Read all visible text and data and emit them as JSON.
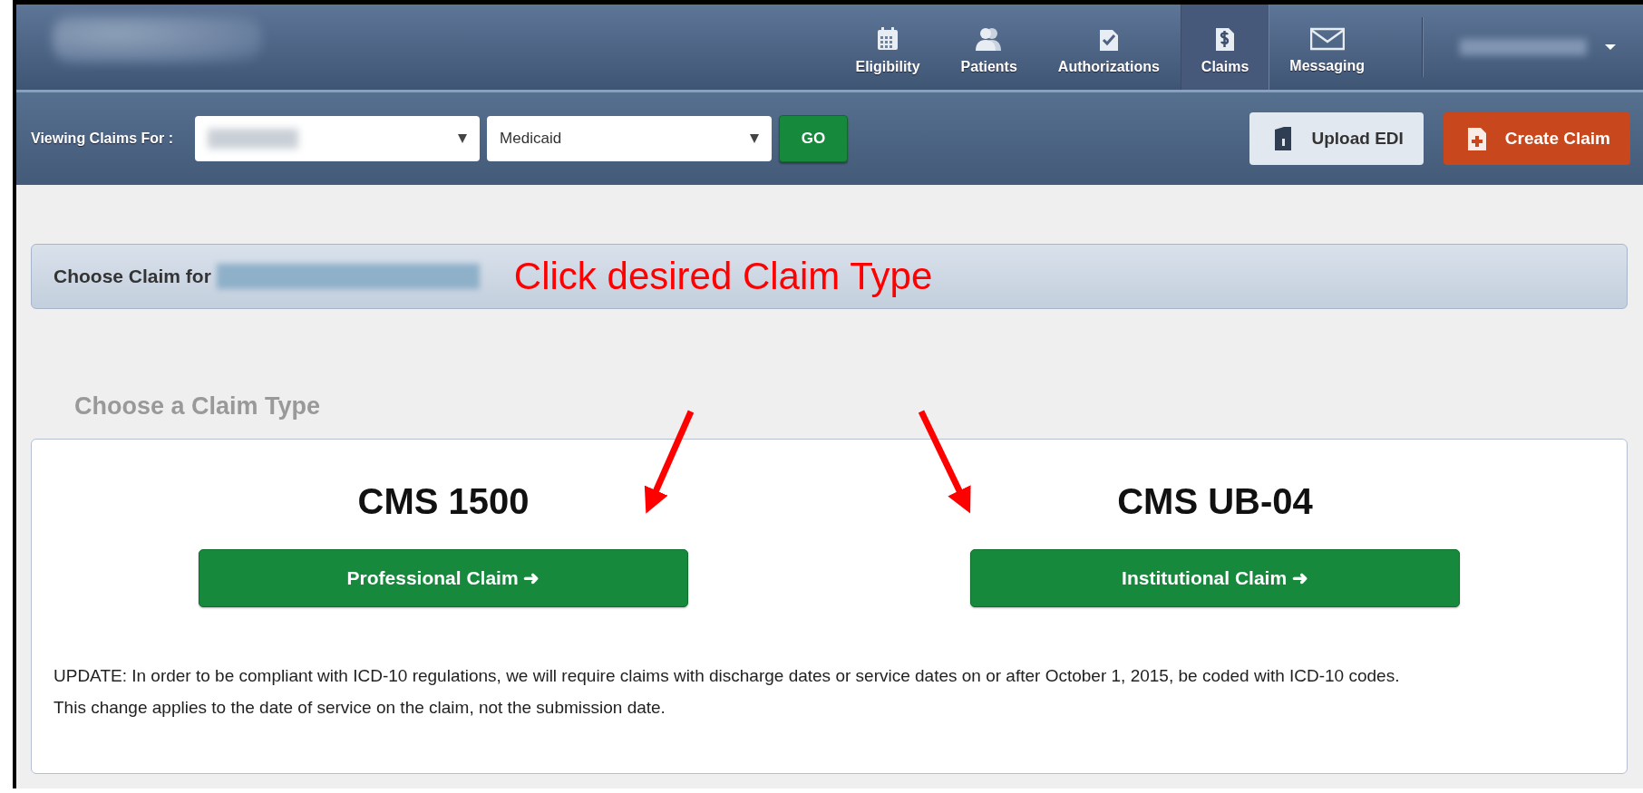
{
  "nav": {
    "items": [
      {
        "label": "Eligibility",
        "kind": "calendar",
        "selected": false
      },
      {
        "label": "Patients",
        "kind": "people",
        "selected": false
      },
      {
        "label": "Authorizations",
        "kind": "check",
        "selected": false
      },
      {
        "label": "Claims",
        "kind": "dollar",
        "selected": true
      },
      {
        "label": "Messaging",
        "kind": "mail",
        "selected": false
      }
    ]
  },
  "toolbar": {
    "label": "Viewing Claims For :",
    "selects": [
      {
        "kind": "redacted"
      },
      {
        "kind": "text",
        "value": "Medicaid"
      }
    ],
    "go": "GO",
    "actions": [
      {
        "label": "Upload EDI",
        "kind": "upload"
      },
      {
        "label": "Create Claim",
        "kind": "create"
      }
    ]
  },
  "header": {
    "title": "Choose Claim for",
    "annotation": "Click desired Claim Type"
  },
  "section_title": "Choose a Claim Type",
  "options": [
    {
      "title": "CMS 1500",
      "button": "Professional Claim ➜"
    },
    {
      "title": "CMS UB-04",
      "button": "Institutional Claim ➜"
    }
  ],
  "notice": [
    "UPDATE: In order to be compliant with ICD-10 regulations, we will require claims with discharge dates or service dates on or after October 1, 2015, be coded with ICD-10 codes.",
    "This change applies to the date of service on the claim, not the submission date."
  ]
}
